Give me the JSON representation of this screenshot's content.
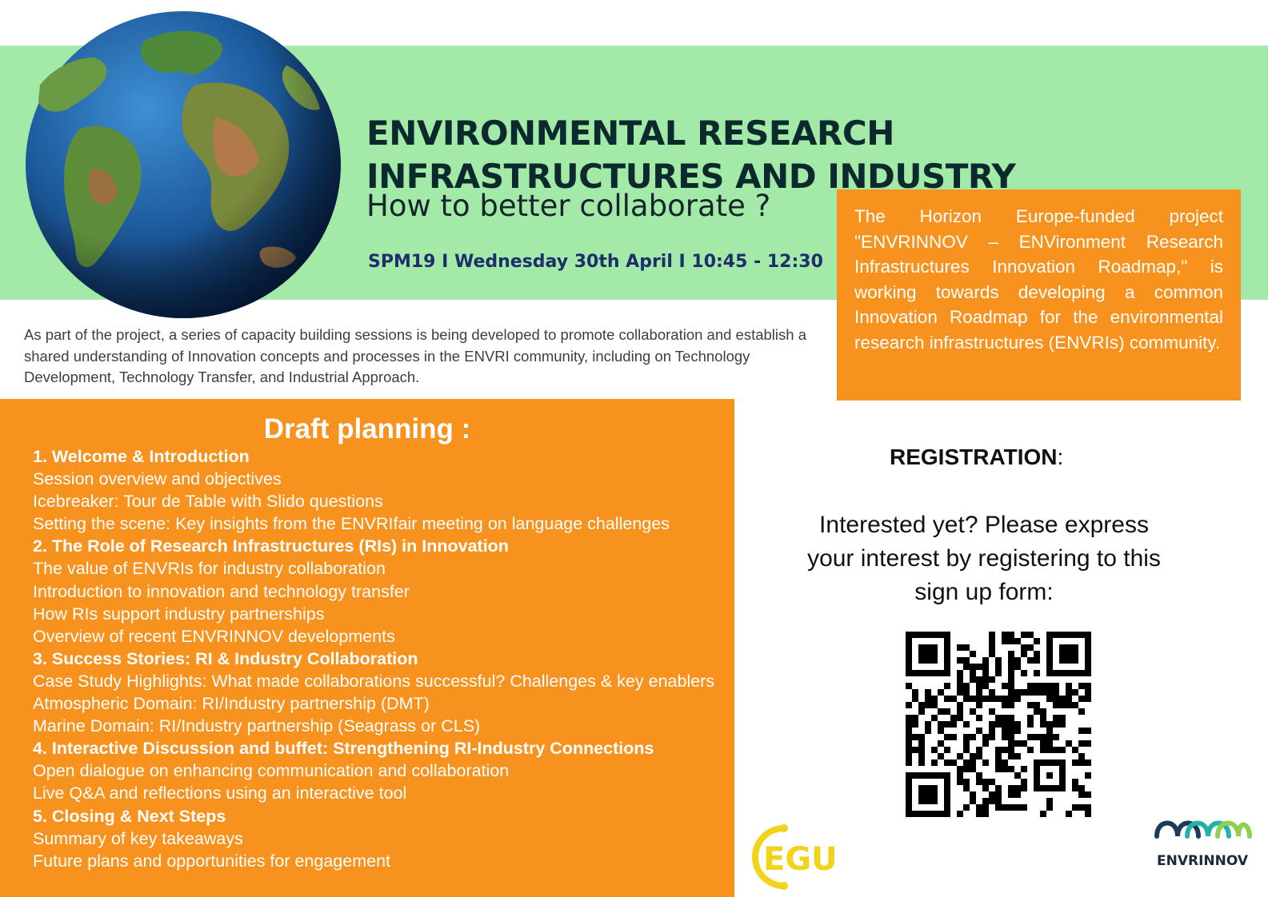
{
  "header": {
    "title": "ENVIRONMENTAL RESEARCH INFRASTRUCTURES AND INDUSTRY",
    "subtitle": "How to better collaborate ?",
    "session": "SPM19 I Wednesday 30th April I 10:45 - 12:30"
  },
  "intro": "As part of the project, a series of capacity building sessions is being developed to promote collaboration and establish a shared understanding of Innovation concepts and processes in the ENVRI community, including on Technology Development, Technology Transfer, and Industrial Approach.",
  "project_box": "The Horizon Europe-funded project \"ENVRINNOV – ENVironment Research Infrastructures Innovation Roadmap,\" is working towards developing a common Innovation Roadmap for the environmental research infrastructures (ENVRIs) community.",
  "planning": {
    "title": "Draft planning :",
    "sections": [
      {
        "heading": "1. Welcome & Introduction",
        "items": [
          "Session overview and objectives",
          "Icebreaker: Tour de Table with Slido questions",
          "Setting the scene: Key insights from the ENVRIfair meeting on language challenges"
        ]
      },
      {
        "heading": "2. The Role of Research Infrastructures (RIs) in Innovation",
        "items": [
          "The value of ENVRIs for industry collaboration",
          "Introduction to innovation and technology transfer",
          "How RIs support industry partnerships",
          "Overview of recent ENVRINNOV developments"
        ]
      },
      {
        "heading": "3. Success Stories: RI & Industry Collaboration",
        "items": [
          "Case Study Highlights: What made collaborations successful? Challenges & key enablers",
          "Atmospheric Domain: RI/Industry partnership (DMT)",
          "Marine Domain: RI/Industry partnership (Seagrass or CLS)"
        ]
      },
      {
        "heading": "4. Interactive Discussion and buffet: Strengthening RI-Industry Connections",
        "items": [
          "Open dialogue on enhancing communication and collaboration",
          "Live Q&A and reflections using an interactive tool"
        ]
      },
      {
        "heading": "5. Closing & Next Steps",
        "items": [
          "Summary of key takeaways",
          "Future plans and opportunities for engagement"
        ]
      }
    ]
  },
  "registration": {
    "title": "REGISTRATION",
    "title_suffix": ":",
    "text": "Interested yet? Please express your interest by registering to this sign up form:"
  },
  "logos": {
    "egu": "EGU",
    "envrinnov": "ENVRINNOV"
  },
  "colors": {
    "green_band": "#a3eaa8",
    "orange": "#f7921e",
    "title": "#0c2a2e",
    "session": "#1e2d6b",
    "egu_yellow": "#f2d21a",
    "envri_teal": "#22b3a8"
  }
}
